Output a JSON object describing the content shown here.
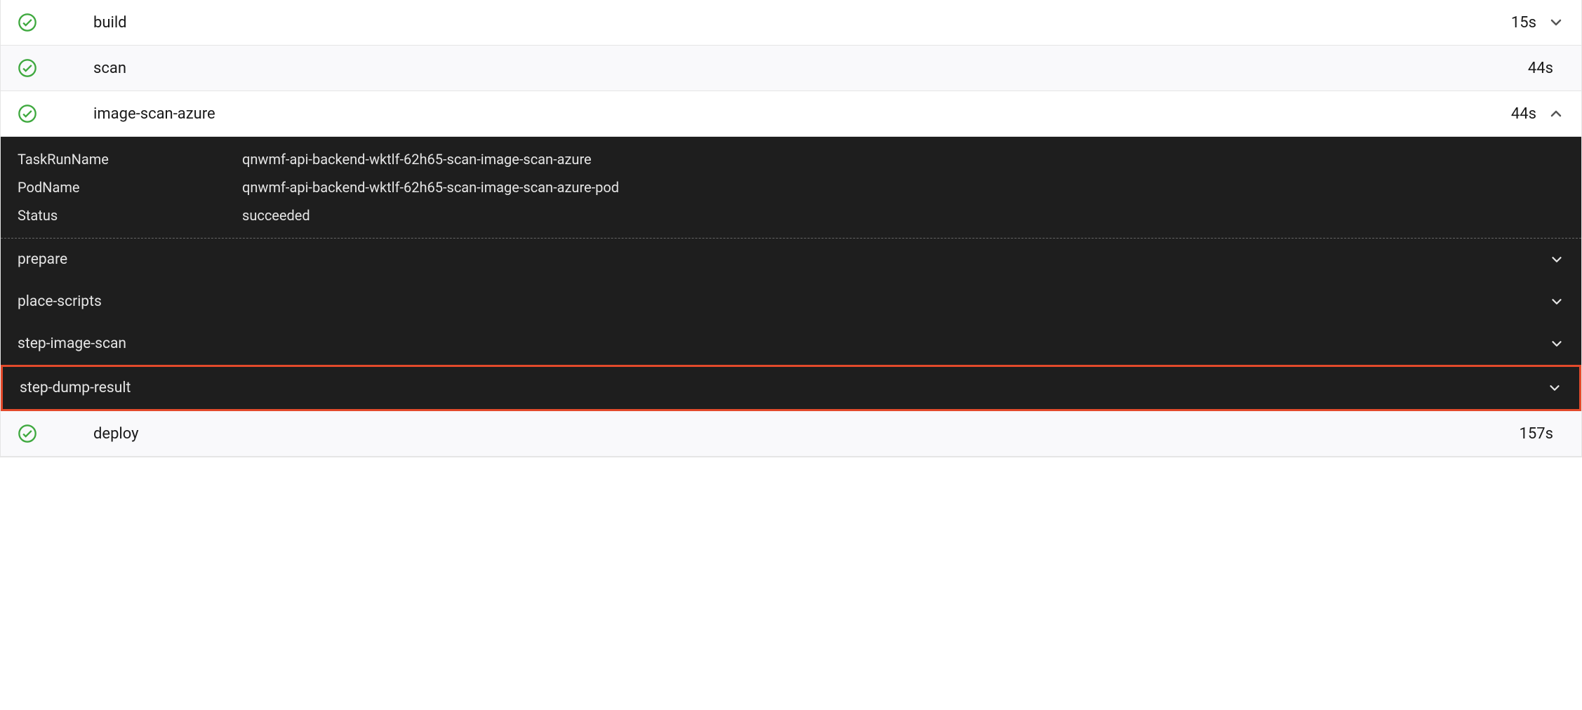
{
  "tasks": [
    {
      "name": "build",
      "duration": "15s",
      "expanded": false,
      "alt": false
    },
    {
      "name": "scan",
      "duration": "44s",
      "expanded": false,
      "alt": true
    },
    {
      "name": "image-scan-azure",
      "duration": "44s",
      "expanded": true,
      "alt": false
    },
    {
      "name": "deploy",
      "duration": "157s",
      "expanded": false,
      "alt": true
    }
  ],
  "details": {
    "meta": [
      {
        "key": "TaskRunName",
        "val": "qnwmf-api-backend-wktlf-62h65-scan-image-scan-azure"
      },
      {
        "key": "PodName",
        "val": "qnwmf-api-backend-wktlf-62h65-scan-image-scan-azure-pod"
      },
      {
        "key": "Status",
        "val": "succeeded"
      }
    ],
    "steps": [
      {
        "name": "prepare",
        "highlighted": false
      },
      {
        "name": "place-scripts",
        "highlighted": false
      },
      {
        "name": "step-image-scan",
        "highlighted": false
      },
      {
        "name": "step-dump-result",
        "highlighted": true
      }
    ]
  }
}
